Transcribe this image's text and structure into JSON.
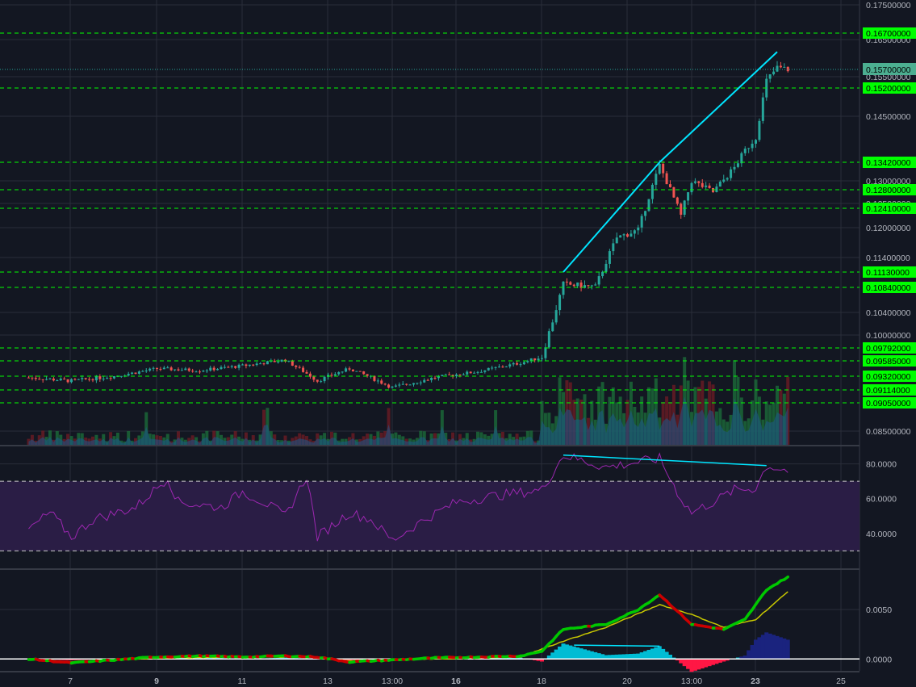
{
  "colors": {
    "background": "#131722",
    "grid": "#2a2e39",
    "up": "#26a69a",
    "down": "#ef5350",
    "level_line": "#00ff00",
    "trendline": "#00e5ff",
    "rsi": "#9c27b0",
    "rsi_band": "#2a1d45",
    "macd_fast": "#00c800",
    "macd_slow": "#c8c800",
    "hist_pos": "#00bcd4",
    "hist_neg": "#ff1744",
    "volume_area": "#1e5a8c"
  },
  "x_axis": {
    "ticks": [
      {
        "label": "7",
        "bold": false
      },
      {
        "label": "9",
        "bold": true
      },
      {
        "label": "11",
        "bold": false
      },
      {
        "label": "13",
        "bold": false
      },
      {
        "label": "13:00",
        "bold": false
      },
      {
        "label": "16",
        "bold": true
      },
      {
        "label": "18",
        "bold": false
      },
      {
        "label": "20",
        "bold": false
      },
      {
        "label": "13:00",
        "bold": false
      },
      {
        "label": "23",
        "bold": true
      },
      {
        "label": "25",
        "bold": false
      }
    ]
  },
  "chart_data": [
    {
      "type": "candlestick",
      "y_axis_labels": [
        "0.17500000",
        "0.16500000",
        "0.15500000",
        "0.14500000",
        "0.13000000",
        "0.12500000",
        "0.12000000",
        "0.11400000",
        "0.10400000",
        "0.10000000",
        "0.08500000"
      ],
      "price_lines": [
        "0.16700000",
        "0.15200000",
        "0.13420000",
        "0.12800000",
        "0.12410000",
        "0.11130000",
        "0.10840000",
        "0.09792000",
        "0.09585000",
        "0.09320000",
        "0.09114000",
        "0.09050000"
      ],
      "last_price": "0.15700000",
      "trendlines": [
        {
          "from": {
            "date": "Dec 18 12:00",
            "price": 0.1113
          },
          "to": {
            "date": "Dec 20 18:00",
            "price": 0.1342
          }
        },
        {
          "from": {
            "date": "Dec 20 18:00",
            "price": 0.1342
          },
          "to": {
            "date": "Dec 23 12:00",
            "price": 0.1617
          }
        }
      ],
      "ohlc_anchors": [
        {
          "date": "Dec 6 00:00",
          "price": 0.093
        },
        {
          "date": "Dec 7 00:00",
          "price": 0.0925
        },
        {
          "date": "Dec 8 00:00",
          "price": 0.0932
        },
        {
          "date": "Dec 9 00:00",
          "price": 0.0945
        },
        {
          "date": "Dec 10 00:00",
          "price": 0.0942
        },
        {
          "date": "Dec 11 00:00",
          "price": 0.095
        },
        {
          "date": "Dec 12 00:00",
          "price": 0.096
        },
        {
          "date": "Dec 12 18:00",
          "price": 0.0925
        },
        {
          "date": "Dec 13 12:00",
          "price": 0.0945
        },
        {
          "date": "Dec 14 12:00",
          "price": 0.0915
        },
        {
          "date": "Dec 15 12:00",
          "price": 0.093
        },
        {
          "date": "Dec 16 12:00",
          "price": 0.094
        },
        {
          "date": "Dec 17 12:00",
          "price": 0.0955
        },
        {
          "date": "Dec 18 00:00",
          "price": 0.0965
        },
        {
          "date": "Dec 18 06:00",
          "price": 0.1025
        },
        {
          "date": "Dec 18 12:00",
          "price": 0.109
        },
        {
          "date": "Dec 19 06:00",
          "price": 0.1085
        },
        {
          "date": "Dec 19 18:00",
          "price": 0.118
        },
        {
          "date": "Dec 20 06:00",
          "price": 0.1195
        },
        {
          "date": "Dec 20 18:00",
          "price": 0.1335
        },
        {
          "date": "Dec 21 06:00",
          "price": 0.1225
        },
        {
          "date": "Dec 21 12:00",
          "price": 0.13
        },
        {
          "date": "Dec 22 00:00",
          "price": 0.1275
        },
        {
          "date": "Dec 22 12:00",
          "price": 0.133
        },
        {
          "date": "Dec 22 18:00",
          "price": 0.137
        },
        {
          "date": "Dec 23 00:00",
          "price": 0.14
        },
        {
          "date": "Dec 23 06:00",
          "price": 0.154
        },
        {
          "date": "Dec 23 12:00",
          "price": 0.1575
        },
        {
          "date": "Dec 23 18:00",
          "price": 0.157
        }
      ]
    },
    {
      "type": "line",
      "y_axis_labels": [
        "80.0000",
        "60.0000",
        "40.0000"
      ],
      "bands": [
        70,
        30
      ],
      "ylim": [
        20,
        90
      ],
      "series_anchors": [
        {
          "date": "Dec 6 00:00",
          "value": 42
        },
        {
          "date": "Dec 6 12:00",
          "value": 52
        },
        {
          "date": "Dec 7 00:00",
          "value": 38
        },
        {
          "date": "Dec 7 12:00",
          "value": 48
        },
        {
          "date": "Dec 8 12:00",
          "value": 55
        },
        {
          "date": "Dec 9 06:00",
          "value": 72
        },
        {
          "date": "Dec 9 12:00",
          "value": 58
        },
        {
          "date": "Dec 10 12:00",
          "value": 55
        },
        {
          "date": "Dec 11 00:00",
          "value": 64
        },
        {
          "date": "Dec 11 12:00",
          "value": 58
        },
        {
          "date": "Dec 12 00:00",
          "value": 50
        },
        {
          "date": "Dec 12 12:00",
          "value": 73
        },
        {
          "date": "Dec 12 18:00",
          "value": 38
        },
        {
          "date": "Dec 13 12:00",
          "value": 52
        },
        {
          "date": "Dec 14 00:00",
          "value": 48
        },
        {
          "date": "Dec 14 12:00",
          "value": 36
        },
        {
          "date": "Dec 15 06:00",
          "value": 48
        },
        {
          "date": "Dec 16 00:00",
          "value": 58
        },
        {
          "date": "Dec 17 00:00",
          "value": 62
        },
        {
          "date": "Dec 18 00:00",
          "value": 65
        },
        {
          "date": "Dec 18 12:00",
          "value": 85
        },
        {
          "date": "Dec 19 12:00",
          "value": 78
        },
        {
          "date": "Dec 20 00:00",
          "value": 80
        },
        {
          "date": "Dec 20 18:00",
          "value": 83
        },
        {
          "date": "Dec 21 06:00",
          "value": 60
        },
        {
          "date": "Dec 21 12:00",
          "value": 52
        },
        {
          "date": "Dec 22 00:00",
          "value": 58
        },
        {
          "date": "Dec 22 12:00",
          "value": 65
        },
        {
          "date": "Dec 23 00:00",
          "value": 66
        },
        {
          "date": "Dec 23 06:00",
          "value": 79
        },
        {
          "date": "Dec 23 18:00",
          "value": 76
        }
      ],
      "divergence_line": [
        {
          "date": "Dec 18 12:00",
          "value": 85
        },
        {
          "date": "Dec 23 06:00",
          "value": 79
        }
      ]
    },
    {
      "type": "line",
      "y_axis_labels": [
        "0.0050",
        "0.0000"
      ],
      "ylim": [
        -0.0012,
        0.009
      ],
      "macd_anchors": [
        {
          "date": "Dec 6 00:00",
          "value": 0.0
        },
        {
          "date": "Dec 7 00:00",
          "value": -0.0004
        },
        {
          "date": "Dec 8 00:00",
          "value": -0.0001
        },
        {
          "date": "Dec 9 00:00",
          "value": 0.0002
        },
        {
          "date": "Dec 10 00:00",
          "value": 0.0003
        },
        {
          "date": "Dec 11 00:00",
          "value": 0.0002
        },
        {
          "date": "Dec 12 00:00",
          "value": 0.0003
        },
        {
          "date": "Dec 12 18:00",
          "value": 0.0002
        },
        {
          "date": "Dec 13 12:00",
          "value": -0.0003
        },
        {
          "date": "Dec 14 12:00",
          "value": -0.0001
        },
        {
          "date": "Dec 15 12:00",
          "value": 0.0001
        },
        {
          "date": "Dec 16 12:00",
          "value": 0.0002
        },
        {
          "date": "Dec 17 12:00",
          "value": 0.0003
        },
        {
          "date": "Dec 18 00:00",
          "value": 0.0008
        },
        {
          "date": "Dec 18 12:00",
          "value": 0.003
        },
        {
          "date": "Dec 19 12:00",
          "value": 0.0035
        },
        {
          "date": "Dec 20 06:00",
          "value": 0.005
        },
        {
          "date": "Dec 20 18:00",
          "value": 0.0065
        },
        {
          "date": "Dec 21 06:00",
          "value": 0.0045
        },
        {
          "date": "Dec 21 12:00",
          "value": 0.0035
        },
        {
          "date": "Dec 22 06:00",
          "value": 0.003
        },
        {
          "date": "Dec 22 18:00",
          "value": 0.004
        },
        {
          "date": "Dec 23 06:00",
          "value": 0.007
        },
        {
          "date": "Dec 23 18:00",
          "value": 0.0083
        }
      ],
      "signal_anchors": [
        {
          "date": "Dec 6 00:00",
          "value": 0.0
        },
        {
          "date": "Dec 7 00:00",
          "value": -0.0003
        },
        {
          "date": "Dec 9 00:00",
          "value": 0.0001
        },
        {
          "date": "Dec 11 00:00",
          "value": 0.0002
        },
        {
          "date": "Dec 12 18:00",
          "value": 0.0002
        },
        {
          "date": "Dec 13 12:00",
          "value": -0.0002
        },
        {
          "date": "Dec 15 12:00",
          "value": 0.0
        },
        {
          "date": "Dec 17 12:00",
          "value": 0.0002
        },
        {
          "date": "Dec 18 12:00",
          "value": 0.0018
        },
        {
          "date": "Dec 19 12:00",
          "value": 0.0032
        },
        {
          "date": "Dec 20 18:00",
          "value": 0.0055
        },
        {
          "date": "Dec 21 12:00",
          "value": 0.0045
        },
        {
          "date": "Dec 22 06:00",
          "value": 0.0032
        },
        {
          "date": "Dec 23 00:00",
          "value": 0.004
        },
        {
          "date": "Dec 23 18:00",
          "value": 0.0068
        }
      ],
      "divergence_line": [
        {
          "date": "Dec 18 18:00",
          "value": 0.0014
        },
        {
          "date": "Dec 20 18:00",
          "value": 0.0013
        }
      ]
    }
  ]
}
